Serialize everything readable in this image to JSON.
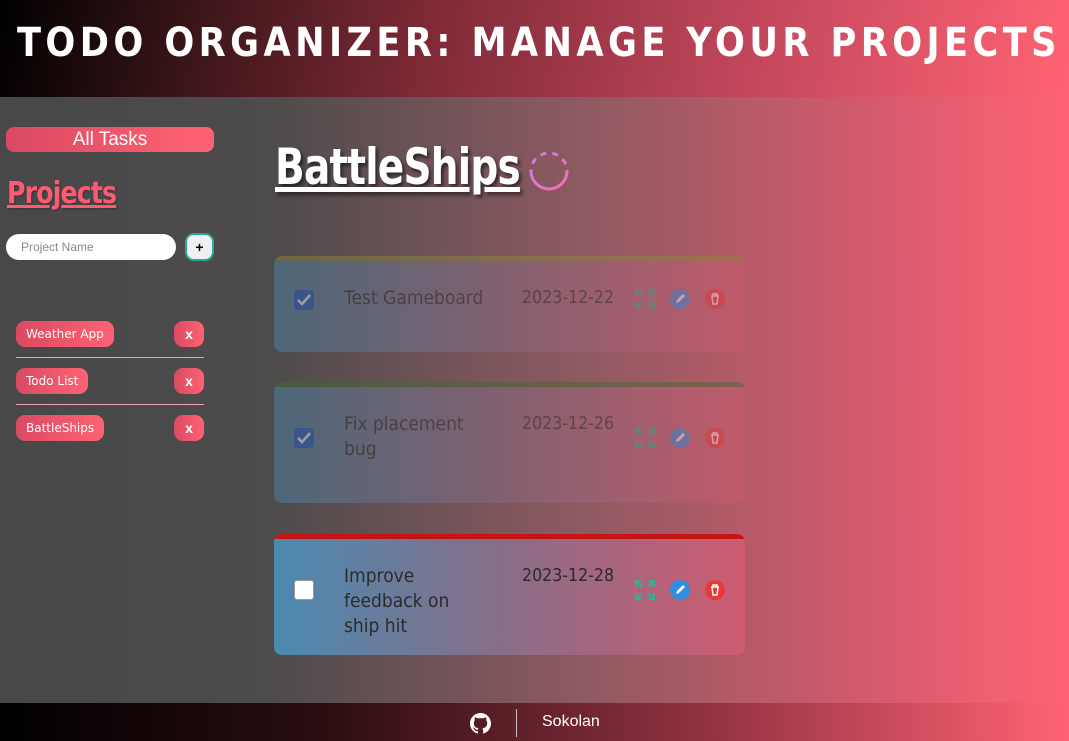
{
  "header": {
    "title": "TODO ORGANIZER: MANAGE YOUR PROJECTS"
  },
  "sidebar": {
    "all_tasks_label": "All Tasks",
    "projects_title": "Projects",
    "project_input": {
      "placeholder": "Project Name",
      "value": ""
    },
    "add_project_label": "+",
    "projects": [
      {
        "name": "Weather App",
        "delete_label": "x"
      },
      {
        "name": "Todo List",
        "delete_label": "x"
      },
      {
        "name": "BattleShips",
        "delete_label": "x"
      }
    ]
  },
  "main": {
    "project_title": "BattleShips",
    "todos": [
      {
        "title": "Test Gameboard",
        "date": "2023-12-22",
        "checked": true,
        "priority_color": "#8e8a3c"
      },
      {
        "title": "Fix placement bug",
        "date": "2023-12-26",
        "checked": true,
        "priority_color": "#3e6b2f"
      },
      {
        "title": "Improve feedback on ship hit",
        "date": "2023-12-28",
        "checked": false,
        "priority_color": "#c41414"
      }
    ]
  },
  "footer": {
    "author": "Sokolan",
    "icon": "github-icon"
  },
  "colors": {
    "accent": "#ff6373",
    "edit": "#2f8de4",
    "delete": "#e83838",
    "expand": "#2ab39a"
  }
}
